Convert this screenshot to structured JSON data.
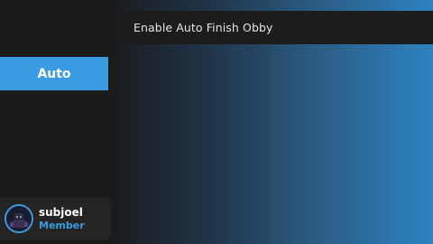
{
  "colors": {
    "accent": "#3a9be0",
    "sidebar_bg": "#1b1b1b",
    "gradient_start": "#1b1d20",
    "gradient_end": "#2d82c0"
  },
  "toggle": {
    "label": "Enable Auto Finish Obby"
  },
  "sidebar": {
    "tabs": [
      {
        "label": "Auto",
        "selected": true
      }
    ]
  },
  "user": {
    "name": "subjoel",
    "role": "Member",
    "avatar_icon": "avatar-icon"
  }
}
